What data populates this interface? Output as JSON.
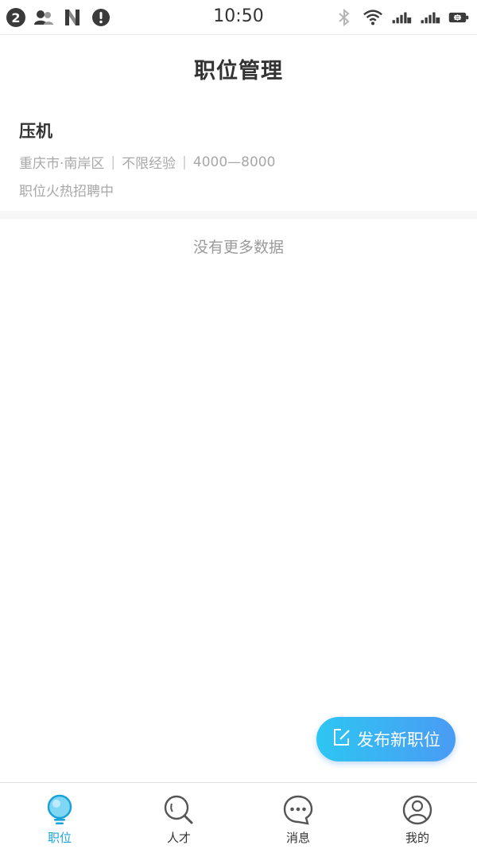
{
  "status_bar": {
    "badge": "2",
    "time": "10:50",
    "icons_left": [
      "contacts-icon",
      "n-logo-icon",
      "alert-icon"
    ],
    "icons_right": [
      "bluetooth-icon",
      "wifi-icon",
      "signal-1-icon",
      "signal-2-icon",
      "battery-charging-icon"
    ]
  },
  "header": {
    "title": "职位管理"
  },
  "job": {
    "title": "压机",
    "location": "重庆市·南岸区",
    "experience": "不限经验",
    "salary": "4000—8000",
    "status": "职位火热招聘中",
    "separator": "|"
  },
  "list": {
    "end_text": "没有更多数据"
  },
  "fab": {
    "label": "发布新职位",
    "icon": "edit-icon"
  },
  "bottom_nav": {
    "items": [
      {
        "label": "职位",
        "icon": "lightbulb-icon",
        "active": true
      },
      {
        "label": "人才",
        "icon": "search-icon",
        "active": false
      },
      {
        "label": "消息",
        "icon": "chat-icon",
        "active": false
      },
      {
        "label": "我的",
        "icon": "user-icon",
        "active": false
      }
    ]
  },
  "colors": {
    "accent": "#1aa3d9",
    "fab_start": "#2ec6f2",
    "fab_end": "#4a9bf4",
    "muted_text": "#a8a8a8"
  }
}
